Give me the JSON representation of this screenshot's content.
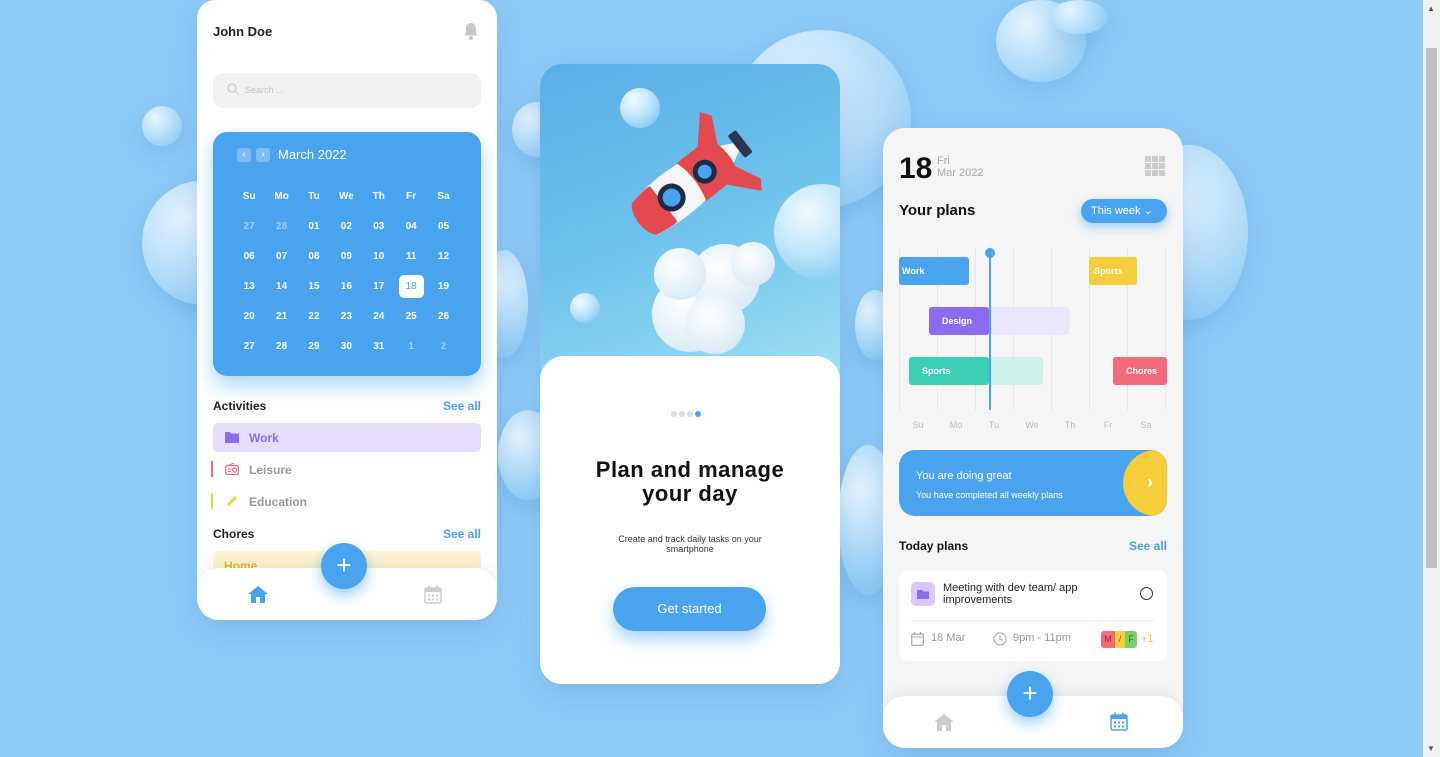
{
  "left": {
    "user_name": "John Doe",
    "search_placeholder": "Search ...",
    "calendar": {
      "month": "March 2022",
      "weekdays": [
        "Su",
        "Mo",
        "Tu",
        "We",
        "Th",
        "Fr",
        "Sa"
      ],
      "days": [
        "27",
        "28",
        "01",
        "02",
        "03",
        "04",
        "05",
        "06",
        "07",
        "08",
        "09",
        "10",
        "11",
        "12",
        "13",
        "14",
        "15",
        "16",
        "17",
        "18",
        "19",
        "20",
        "21",
        "22",
        "23",
        "24",
        "25",
        "26",
        "27",
        "28",
        "29",
        "30",
        "31",
        "1",
        "2"
      ],
      "selected": "18"
    },
    "activities": {
      "title": "Activities",
      "see_all": "See all",
      "items": [
        {
          "label": "Work",
          "color": "#8b6cf1"
        },
        {
          "label": "Leisure",
          "color": "#f26b7a"
        },
        {
          "label": "Education",
          "color": "#f6cd3c"
        }
      ]
    },
    "chores": {
      "title": "Chores",
      "see_all": "See all",
      "items": [
        {
          "label": "Home",
          "color": "#f0c030"
        }
      ]
    },
    "fab": "+"
  },
  "middle": {
    "title_line1": "Plan and manage",
    "title_line2": "your day",
    "subtitle": "Create and track daily tasks on your smartphone",
    "button": "Get started"
  },
  "right": {
    "day": "18",
    "weekday": "Fri",
    "month_year": "Mar 2022",
    "plans_title": "Your plans",
    "week_button": "This week",
    "gantt": [
      {
        "label": "Work",
        "color": "#4aa3ee"
      },
      {
        "label": "Sports",
        "color": "#f6cd3c"
      },
      {
        "label": "Design",
        "color": "#8b6cf1"
      },
      {
        "label": "Sports",
        "color": "#3dcfb6"
      },
      {
        "label": "Chores",
        "color": "#f26b7a"
      }
    ],
    "days": [
      "Su",
      "Mo",
      "Tu",
      "We",
      "Th",
      "Fr",
      "Sa"
    ],
    "banner_title": "You are doing great",
    "banner_sub": "You have completed all weekly plans",
    "today_title": "Today plans",
    "today_see_all": "See all",
    "meeting": {
      "title": "Meeting with dev team/ app improvements",
      "date": "18 Mar",
      "time": "9pm - 11pm",
      "tags": [
        "M",
        "/",
        "F"
      ],
      "more": "+1"
    },
    "fab": "+"
  },
  "colors": {
    "background": "#8fcbf7",
    "accent": "#4aa3ee",
    "yellow": "#f6cd3c"
  }
}
